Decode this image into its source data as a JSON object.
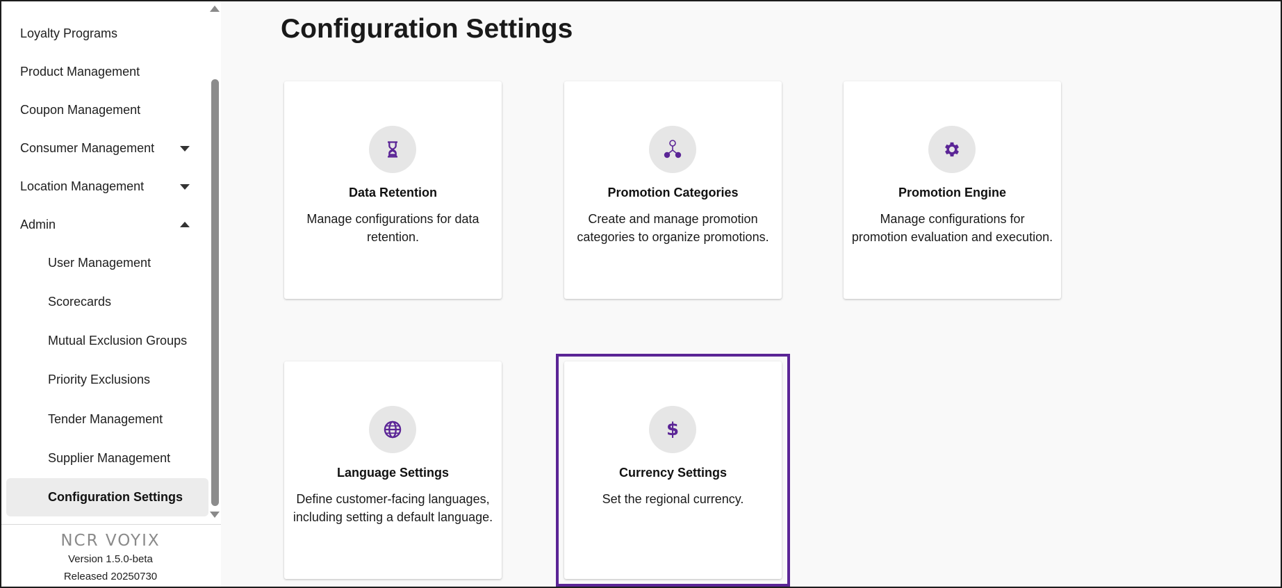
{
  "sidebar": {
    "items": [
      {
        "label": "Loyalty Programs"
      },
      {
        "label": "Product Management"
      },
      {
        "label": "Coupon Management"
      },
      {
        "label": "Consumer Management"
      },
      {
        "label": "Location Management"
      },
      {
        "label": "Admin"
      },
      {
        "label": "User Management"
      },
      {
        "label": "Scorecards"
      },
      {
        "label": "Mutual Exclusion Groups"
      },
      {
        "label": "Priority Exclusions"
      },
      {
        "label": "Tender Management"
      },
      {
        "label": "Supplier Management"
      },
      {
        "label": "Configuration Settings"
      }
    ],
    "active_item": "Configuration Settings"
  },
  "footer": {
    "logo": "NCR VOYIX",
    "version": "Version 1.5.0-beta",
    "released": "Released 20250730"
  },
  "main": {
    "title": "Configuration Settings",
    "cards": [
      {
        "title": "Data Retention",
        "description": "Manage configurations for data retention.",
        "icon": "hourglass-icon"
      },
      {
        "title": "Promotion Categories",
        "description": "Create and manage promotion categories to organize promotions.",
        "icon": "category-tree-icon"
      },
      {
        "title": "Promotion Engine",
        "description": "Manage configurations for promotion evaluation and execution.",
        "icon": "gear-icon"
      },
      {
        "title": "Language Settings",
        "description": "Define customer-facing languages, including setting a default language.",
        "icon": "globe-icon"
      },
      {
        "title": "Currency Settings",
        "description": "Set the regional currency.",
        "icon": "dollar-icon"
      }
    ],
    "highlighted_card": "Currency Settings"
  },
  "colors": {
    "accent": "#5b2596",
    "icon_bg": "#e6e6e6",
    "active_nav_bg": "#ececec"
  }
}
